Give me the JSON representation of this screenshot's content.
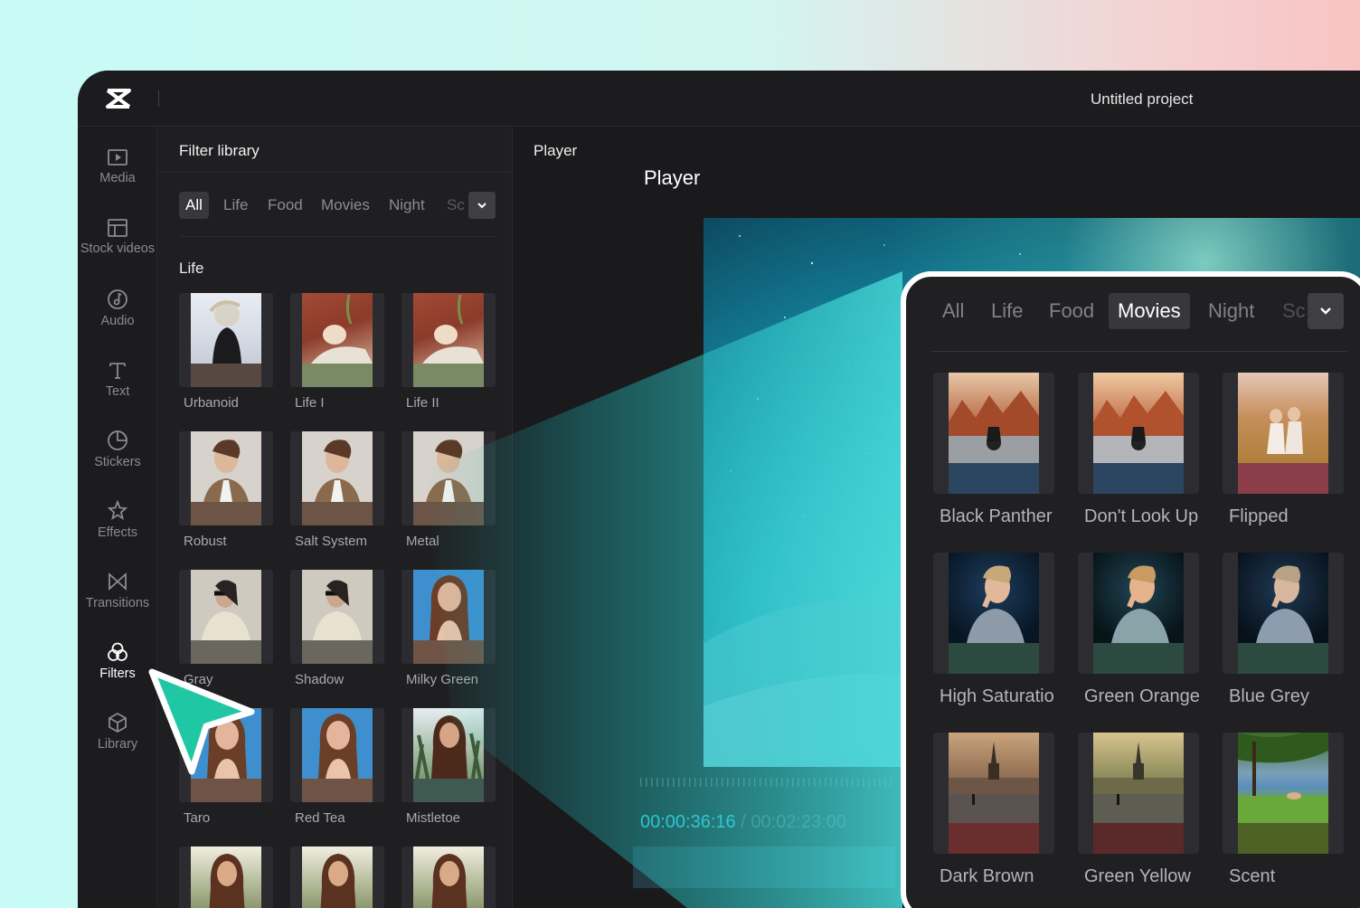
{
  "topbar": {
    "project_title": "Untitled project"
  },
  "sidebar": {
    "items": [
      {
        "label": "Media",
        "icon": "media-icon"
      },
      {
        "label": "Stock videos",
        "icon": "stock-videos-icon"
      },
      {
        "label": "Audio",
        "icon": "audio-icon"
      },
      {
        "label": "Text",
        "icon": "text-icon"
      },
      {
        "label": "Stickers",
        "icon": "stickers-icon"
      },
      {
        "label": "Effects",
        "icon": "effects-icon"
      },
      {
        "label": "Transitions",
        "icon": "transitions-icon"
      },
      {
        "label": "Filters",
        "icon": "filters-icon",
        "active": true
      },
      {
        "label": "Library",
        "icon": "library-icon"
      }
    ]
  },
  "filter_panel": {
    "title": "Filter library",
    "tabs": [
      "All",
      "Life",
      "Food",
      "Movies",
      "Night",
      "Sc"
    ],
    "active_tab": "All",
    "section_title": "Life",
    "items": [
      {
        "label": "Urbanoid",
        "strip": "#574941"
      },
      {
        "label": "Life I",
        "strip": "#7a8a64"
      },
      {
        "label": "Life II",
        "strip": "#7a8a64"
      },
      {
        "label": "Robust",
        "strip": "#6c5446"
      },
      {
        "label": "Salt System",
        "strip": "#6c5446"
      },
      {
        "label": "Metal",
        "strip": "#6c5446"
      },
      {
        "label": "Gray",
        "strip": "#6a675f"
      },
      {
        "label": "Shadow",
        "strip": "#6a675f"
      },
      {
        "label": "Milky Green",
        "strip": "#6f5446"
      },
      {
        "label": "Taro",
        "strip": "#6f5446"
      },
      {
        "label": "Red Tea",
        "strip": "#6f5446"
      },
      {
        "label": "Mistletoe",
        "strip": "#3f5a50"
      },
      {
        "label": "",
        "strip": "#6f5446"
      },
      {
        "label": "",
        "strip": "#6f5446"
      },
      {
        "label": "",
        "strip": "#6f5446"
      }
    ]
  },
  "player": {
    "header": "Player",
    "title": "Player",
    "current_time": "00:00:36:16",
    "separator": "/",
    "total_time": "00:02:23:00"
  },
  "zoom_panel": {
    "tabs": [
      "All",
      "Life",
      "Food",
      "Movies",
      "Night",
      "Sc"
    ],
    "active_tab": "Movies",
    "items": [
      {
        "label": "Black Panther",
        "strip": "#2c4560"
      },
      {
        "label": "Don't Look Up",
        "strip": "#2c4560"
      },
      {
        "label": "Flipped",
        "strip": "#8b3d4a"
      },
      {
        "label": "High Saturatio",
        "strip": "#2d4a40"
      },
      {
        "label": "Green Orange",
        "strip": "#2d4a40"
      },
      {
        "label": "Blue Grey",
        "strip": "#2d4a40"
      },
      {
        "label": "Dark Brown",
        "strip": "#6b2e2e"
      },
      {
        "label": "Green Yellow",
        "strip": "#5a2a2a"
      },
      {
        "label": "Scent",
        "strip": "#4d6124"
      }
    ]
  },
  "colors": {
    "accent": "#2ecbe2",
    "cursor": "#1fc7a4"
  }
}
